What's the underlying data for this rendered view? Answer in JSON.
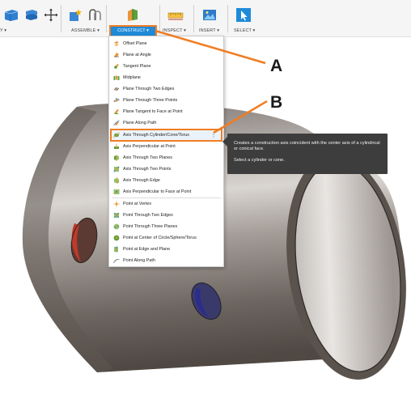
{
  "toolbar": {
    "groups": [
      {
        "label": "Y ▾"
      },
      {
        "label": "ASSEMBLE ▾"
      },
      {
        "label": "CONSTRUCT ▾"
      },
      {
        "label": "INSPECT ▾"
      },
      {
        "label": "INSERT ▾"
      },
      {
        "label": "SELECT ▾"
      }
    ]
  },
  "menu": {
    "items": [
      {
        "label": "Offset Plane",
        "icon": "offset-plane-icon"
      },
      {
        "label": "Plane at Angle",
        "icon": "plane-at-angle-icon"
      },
      {
        "label": "Tangent Plane",
        "icon": "tangent-plane-icon"
      },
      {
        "label": "Midplane",
        "icon": "midplane-icon"
      },
      {
        "label": "Plane Through Two Edges",
        "icon": "plane-two-edges-icon"
      },
      {
        "label": "Plane Through Three Points",
        "icon": "plane-three-points-icon"
      },
      {
        "label": "Plane Tangent to Face at Point",
        "icon": "plane-tangent-face-icon"
      },
      {
        "label": "Plane Along Path",
        "icon": "plane-along-path-icon"
      },
      {
        "label": "Axis Through Cylinder/Cone/Torus",
        "icon": "axis-cylinder-icon"
      },
      {
        "label": "Axis Perpendicular at Point",
        "icon": "axis-perp-point-icon"
      },
      {
        "label": "Axis Through Two Planes",
        "icon": "axis-two-planes-icon"
      },
      {
        "label": "Axis Through Two Points",
        "icon": "axis-two-points-icon"
      },
      {
        "label": "Axis Through Edge",
        "icon": "axis-edge-icon"
      },
      {
        "label": "Axis Perpendicular to Face at Point",
        "icon": "axis-perp-face-icon"
      },
      {
        "label": "Point at Vertex",
        "icon": "point-vertex-icon"
      },
      {
        "label": "Point Through Two Edges",
        "icon": "point-two-edges-icon"
      },
      {
        "label": "Point Through Three Planes",
        "icon": "point-three-planes-icon"
      },
      {
        "label": "Point at Center of Circle/Sphere/Torus",
        "icon": "point-center-icon"
      },
      {
        "label": "Point at Edge and Plane",
        "icon": "point-edge-plane-icon"
      },
      {
        "label": "Point Along Path",
        "icon": "point-along-path-icon"
      }
    ],
    "more_glyph": "⋮"
  },
  "tooltip": {
    "description": "Creates a construction axis coincident with the center axis of a cylindrical or conical face.",
    "instruction": "Select a cylinder or cone."
  },
  "callouts": {
    "a": "A",
    "b": "B"
  },
  "colors": {
    "accent_orange": "#f07d22",
    "construct_blue": "#1e8ad8",
    "tooltip_bg": "#3d3d3d"
  }
}
